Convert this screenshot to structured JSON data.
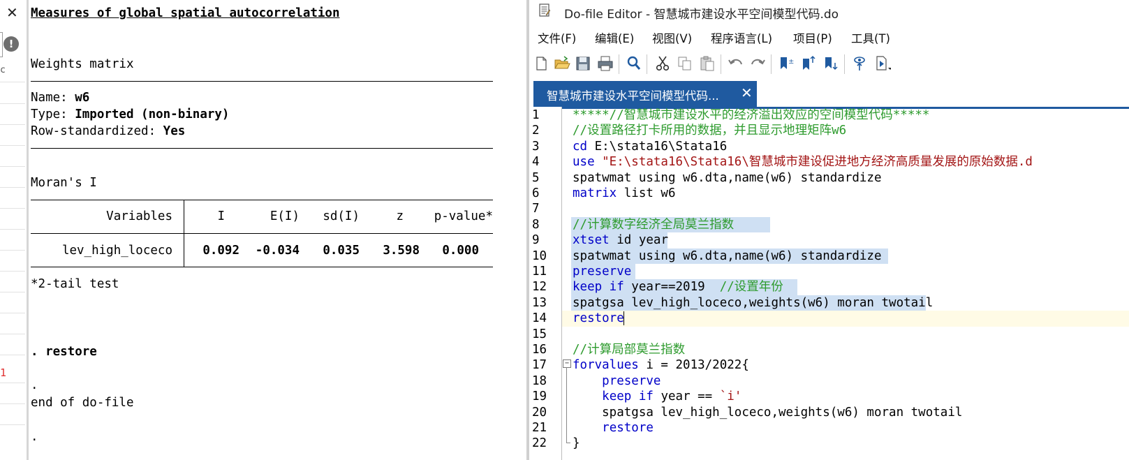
{
  "results": {
    "header": "Measures of global spatial autocorrelation",
    "weights_label": "Weights matrix",
    "name_label": "Name: ",
    "name_value": "w6",
    "type_label": "Type: ",
    "type_value": "Imported (non-binary)",
    "rowstd_label": "Row-standardized: ",
    "rowstd_value": "Yes",
    "moran_label": "Moran's I",
    "table": {
      "headers": [
        "Variables",
        "I",
        "E(I)",
        "sd(I)",
        "z",
        "p-value*"
      ],
      "row": [
        "lev_high_loceco",
        "0.092",
        "-0.034",
        "0.035",
        "3.598",
        "0.000"
      ]
    },
    "footnote": "*2-tail test",
    "restore_cmd": ". restore",
    "dot": ".",
    "end_msg": "end of do-file",
    "dot2": "."
  },
  "left_panel": {
    "close_glyph": "✕",
    "alert_glyph": "!",
    "partial_char": "c",
    "red_number": "1"
  },
  "editor": {
    "title": "Do-file Editor - 智慧城市建设水平空间模型代码.do",
    "menu": [
      "文件(F)",
      "编辑(E)",
      "视图(V)",
      "程序语言(L)",
      "项目(P)",
      "工具(T)"
    ],
    "toolbar_icons": [
      "new-file-icon",
      "open-folder-icon",
      "save-icon",
      "print-icon",
      "find-icon",
      "cut-icon",
      "copy-icon",
      "paste-icon",
      "undo-icon",
      "redo-icon",
      "bookmark-toggle-icon",
      "bookmark-prev-icon",
      "bookmark-next-icon",
      "show-icon",
      "execute-icon"
    ],
    "tab_label": "智慧城市建设水平空间模型代码...",
    "tab_close": "✕",
    "colors": {
      "accent": "#1f5aa0",
      "comment": "#2e9b2e",
      "keyword": "#0000c8",
      "string": "#a31515",
      "selection": "#cfe0f3"
    },
    "lines": [
      [
        {
          "t": "*****//智慧城市建设水平的经济溢出效应的空间模型代码*****",
          "c": "c-com"
        }
      ],
      [
        {
          "t": "//设置路径打卡所用的数据，并且显示地理矩阵w6",
          "c": "c-com"
        }
      ],
      [
        {
          "t": "cd",
          "c": "c-kw"
        },
        {
          "t": " E:\\stata16\\Stata16",
          "c": "c-def"
        }
      ],
      [
        {
          "t": "use",
          "c": "c-kw"
        },
        {
          "t": " \"E:\\stata16\\Stata16\\",
          "c": "c-str"
        },
        {
          "t": "智慧城市建设促进地方经济高质量发展的原始数据.d",
          "c": "c-str"
        }
      ],
      [
        {
          "t": "spatwmat using w6.dta,name(w6) standardize",
          "c": "c-def"
        }
      ],
      [
        {
          "t": "matrix",
          "c": "c-kw"
        },
        {
          "t": " list w6",
          "c": "c-def"
        }
      ],
      [],
      [
        {
          "t": "//计算数字经济全局莫兰指数",
          "c": "c-com"
        }
      ],
      [
        {
          "t": "xtset",
          "c": "c-kw"
        },
        {
          "t": " id year",
          "c": "c-def"
        }
      ],
      [
        {
          "t": "spatwmat using w6.dta,name(w6) standardize",
          "c": "c-def"
        }
      ],
      [
        {
          "t": "preserve",
          "c": "c-kw"
        }
      ],
      [
        {
          "t": "keep if",
          "c": "c-kw"
        },
        {
          "t": " year==2019  ",
          "c": "c-def"
        },
        {
          "t": "//设置年份",
          "c": "c-com"
        }
      ],
      [
        {
          "t": "spatgsa lev_high_loceco,weights(w6) moran twotail",
          "c": "c-def"
        }
      ],
      [
        {
          "t": "restore",
          "c": "c-kw"
        }
      ],
      [],
      [
        {
          "t": "//计算局部莫兰指数",
          "c": "c-com"
        }
      ],
      [
        {
          "t": "forvalues",
          "c": "c-kw"
        },
        {
          "t": " i = 2013/2022{",
          "c": "c-def"
        }
      ],
      [
        {
          "t": "    ",
          "c": "c-def"
        },
        {
          "t": "preserve",
          "c": "c-kw"
        }
      ],
      [
        {
          "t": "    ",
          "c": "c-def"
        },
        {
          "t": "keep if",
          "c": "c-kw"
        },
        {
          "t": " year == ",
          "c": "c-def"
        },
        {
          "t": "`i'",
          "c": "c-str"
        }
      ],
      [
        {
          "t": "    spatgsa lev_high_loceco,weights(w6) moran twotail",
          "c": "c-def"
        }
      ],
      [
        {
          "t": "    ",
          "c": "c-def"
        },
        {
          "t": "restore",
          "c": "c-kw"
        }
      ],
      [
        {
          "t": "}",
          "c": "c-def"
        }
      ]
    ]
  }
}
